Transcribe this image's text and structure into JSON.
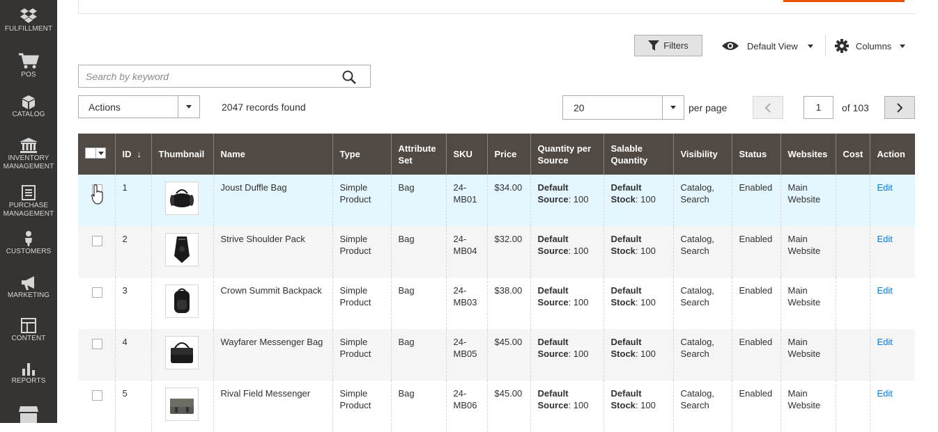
{
  "sidebar": {
    "items": [
      {
        "label": "FULFILLMENT",
        "icon": "dropbox-icon"
      },
      {
        "label": "POS",
        "icon": "cart-icon"
      },
      {
        "label": "CATALOG",
        "icon": "cube-icon"
      },
      {
        "label": "INVENTORY MANAGEMENT",
        "icon": "bank-icon"
      },
      {
        "label": "PURCHASE MANAGEMENT",
        "icon": "document-icon"
      },
      {
        "label": "CUSTOMERS",
        "icon": "person-icon"
      },
      {
        "label": "MARKETING",
        "icon": "megaphone-icon"
      },
      {
        "label": "CONTENT",
        "icon": "layout-icon"
      },
      {
        "label": "REPORTS",
        "icon": "bar-chart-icon"
      },
      {
        "label": "",
        "icon": "store-icon"
      }
    ]
  },
  "toolbar": {
    "filters_label": "Filters",
    "view_label": "Default View",
    "columns_label": "Columns",
    "search_placeholder": "Search by keyword",
    "actions_label": "Actions",
    "records_found": "2047 records found",
    "per_page_value": "20",
    "per_page_label": "per page",
    "page_current": "1",
    "page_of": "of 103"
  },
  "grid": {
    "headers": {
      "id": "ID",
      "sort_arrow": "↓",
      "thumbnail": "Thumbnail",
      "name": "Name",
      "type": "Type",
      "attribute_set": "Attribute Set",
      "sku": "SKU",
      "price": "Price",
      "qty_per_source": "Quantity per Source",
      "salable_qty": "Salable Quantity",
      "visibility": "Visibility",
      "status": "Status",
      "websites": "Websites",
      "cost": "Cost",
      "action": "Action"
    },
    "rows": [
      {
        "id": "1",
        "name": "Joust Duffle Bag",
        "type": "Simple Product",
        "attribute_set": "Bag",
        "sku": "24-MB01",
        "price": "$34.00",
        "qty_label": "Default Source",
        "qty_value": ": 100",
        "salable_label": "Default Stock",
        "salable_value": ": 100",
        "visibility": "Catalog, Search",
        "status": "Enabled",
        "websites": "Main Website",
        "cost": "",
        "action": "Edit",
        "thumb": "duffle-bag-image"
      },
      {
        "id": "2",
        "name": "Strive Shoulder Pack",
        "type": "Simple Product",
        "attribute_set": "Bag",
        "sku": "24-MB04",
        "price": "$32.00",
        "qty_label": "Default Source",
        "qty_value": ": 100",
        "salable_label": "Default Stock",
        "salable_value": ": 100",
        "visibility": "Catalog, Search",
        "status": "Enabled",
        "websites": "Main Website",
        "cost": "",
        "action": "Edit",
        "thumb": "shoulder-pack-image"
      },
      {
        "id": "3",
        "name": "Crown Summit Backpack",
        "type": "Simple Product",
        "attribute_set": "Bag",
        "sku": "24-MB03",
        "price": "$38.00",
        "qty_label": "Default Source",
        "qty_value": ": 100",
        "salable_label": "Default Stock",
        "salable_value": ": 100",
        "visibility": "Catalog, Search",
        "status": "Enabled",
        "websites": "Main Website",
        "cost": "",
        "action": "Edit",
        "thumb": "backpack-image"
      },
      {
        "id": "4",
        "name": "Wayfarer Messenger Bag",
        "type": "Simple Product",
        "attribute_set": "Bag",
        "sku": "24-MB05",
        "price": "$45.00",
        "qty_label": "Default Source",
        "qty_value": ": 100",
        "salable_label": "Default Stock",
        "salable_value": ": 100",
        "visibility": "Catalog, Search",
        "status": "Enabled",
        "websites": "Main Website",
        "cost": "",
        "action": "Edit",
        "thumb": "messenger-bag-image"
      },
      {
        "id": "5",
        "name": "Rival Field Messenger",
        "type": "Simple Product",
        "attribute_set": "Bag",
        "sku": "24-MB06",
        "price": "$45.00",
        "qty_label": "Default Source",
        "qty_value": ": 100",
        "salable_label": "Default Stock",
        "salable_value": ": 100",
        "visibility": "Catalog, Search",
        "status": "Enabled",
        "websites": "Main Website",
        "cost": "",
        "action": "Edit",
        "thumb": "field-messenger-image"
      }
    ]
  },
  "colors": {
    "sidebar_bg": "#373330",
    "header_bg": "#514943",
    "accent": "#eb5202",
    "link": "#007bdb",
    "hover_row": "#e5f7fe"
  }
}
